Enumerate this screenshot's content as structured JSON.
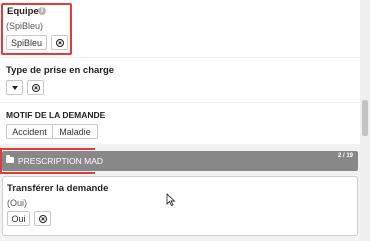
{
  "equipe": {
    "label": "Equipe",
    "sub": "(SpiBleu)",
    "value": "SpiBleu"
  },
  "type_prise": {
    "label": "Type de prise en charge"
  },
  "motif": {
    "label": "MOTIF DE LA DEMANDE",
    "options": [
      "Accident",
      "Maladie"
    ]
  },
  "section": {
    "title": "PRESCRIPTION MAD",
    "count": "2 / 19"
  },
  "transfer": {
    "label": "Transférer la demande",
    "sub": "(Oui)",
    "value": "Oui"
  },
  "icons": {
    "info": "info-icon",
    "clear": "clear-icon",
    "caret": "caret-down-icon",
    "folder": "folder-icon",
    "cursor": "mouse-pointer-icon"
  },
  "colors": {
    "highlight": "#e53a3a",
    "section_bar": "#888888"
  }
}
